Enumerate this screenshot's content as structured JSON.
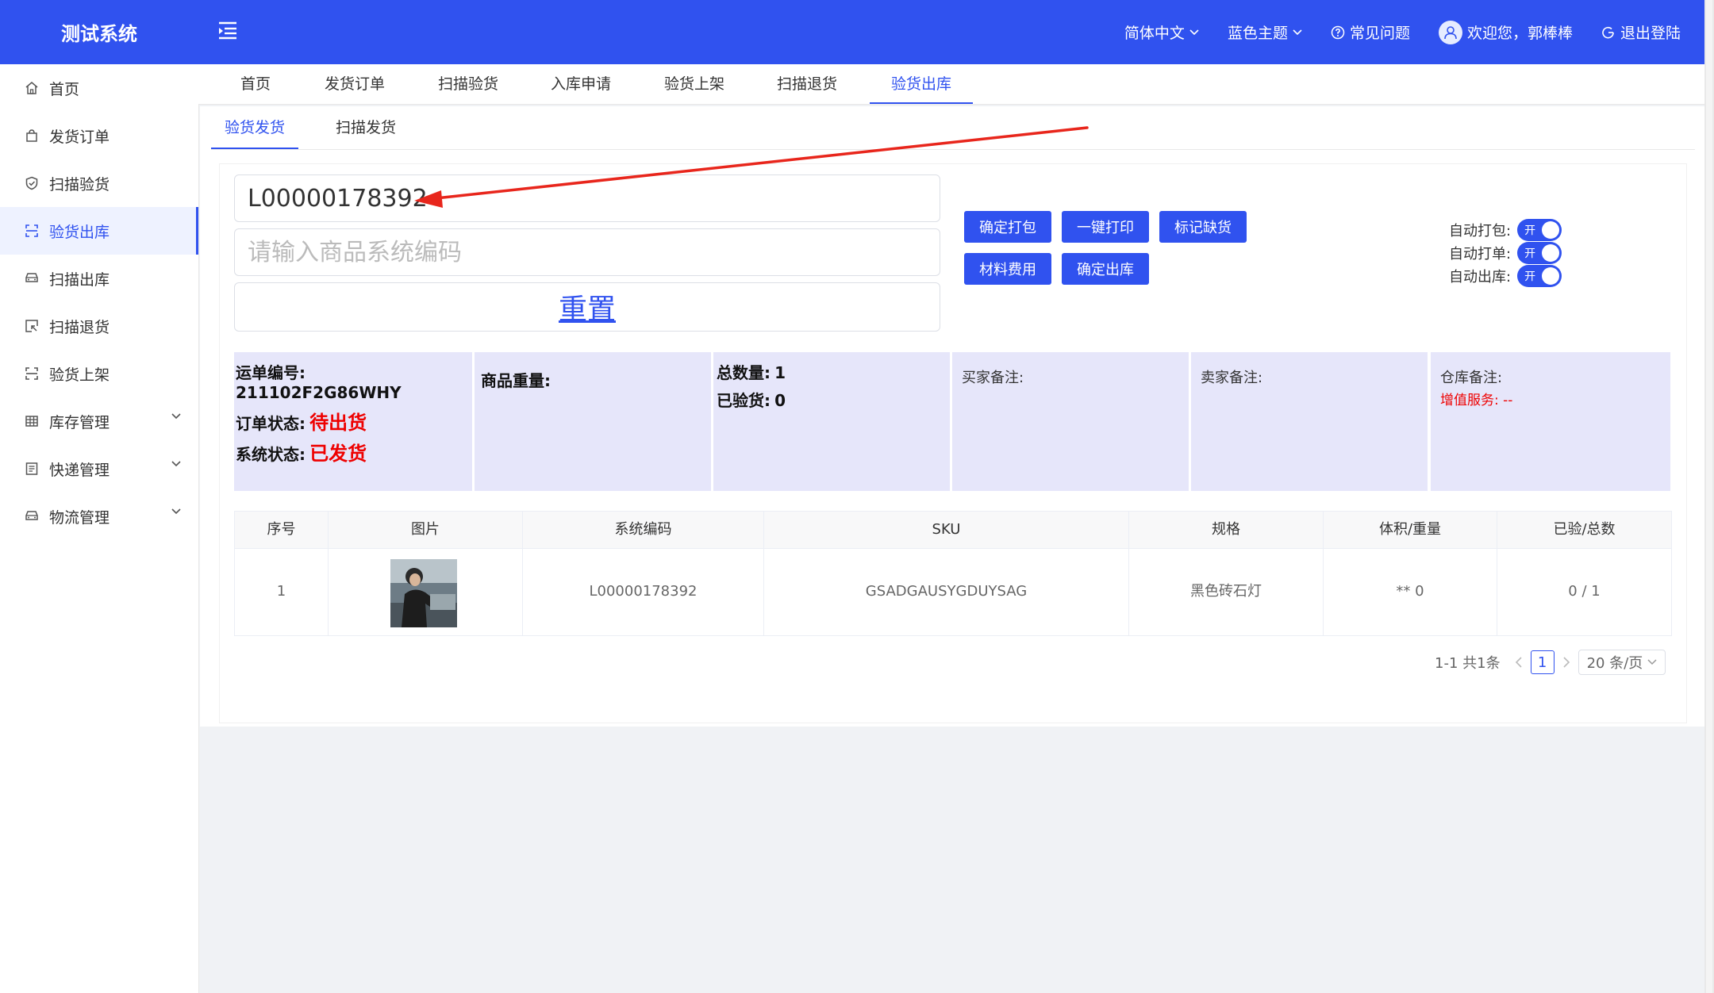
{
  "app": {
    "title": "测试系统"
  },
  "header": {
    "language": "简体中文",
    "theme": "蓝色主题",
    "faq": "常见问题",
    "welcome": "欢迎您，郭棒棒",
    "logout": "退出登陆"
  },
  "sidebar": {
    "items": [
      {
        "label": "首页",
        "icon": "home-icon"
      },
      {
        "label": "发货订单",
        "icon": "bag-icon"
      },
      {
        "label": "扫描验货",
        "icon": "shield-icon"
      },
      {
        "label": "验货出库",
        "icon": "scan-icon"
      },
      {
        "label": "扫描出库",
        "icon": "car-icon"
      },
      {
        "label": "扫描退货",
        "icon": "return-icon"
      },
      {
        "label": "验货上架",
        "icon": "scan-icon"
      },
      {
        "label": "库存管理",
        "icon": "table-icon"
      },
      {
        "label": "快递管理",
        "icon": "list-icon"
      },
      {
        "label": "物流管理",
        "icon": "truck-icon"
      }
    ],
    "active_index": 3
  },
  "tabs": [
    "首页",
    "发货订单",
    "扫描验货",
    "入库申请",
    "验货上架",
    "扫描退货",
    "验货出库"
  ],
  "subtabs": [
    "验货发货",
    "扫描发货"
  ],
  "form": {
    "waybill_value": "L00000178392",
    "product_placeholder": "请输入商品系统编码",
    "reset_label": "重置"
  },
  "actions": {
    "confirm_pack": "确定打包",
    "one_click_print": "一键打印",
    "mark_shortage": "标记缺货",
    "material_cost": "材料费用",
    "confirm_outbound": "确定出库"
  },
  "toggles": [
    {
      "label": "自动打包:",
      "state": "开"
    },
    {
      "label": "自动打单:",
      "state": "开"
    },
    {
      "label": "自动出库:",
      "state": "开"
    }
  ],
  "info": {
    "waybill_label": "运单编号:",
    "waybill_no": "211102F2G86WHY",
    "order_status_label": "订单状态:",
    "order_status": "待出货",
    "system_status_label": "系统状态:",
    "system_status": "已发货",
    "weight_label": "商品重量:",
    "total_label": "总数量:",
    "total_value": "1",
    "checked_label": "已验货:",
    "checked_value": "0",
    "buyer_note_label": "买家备注:",
    "seller_note_label": "卖家备注:",
    "warehouse_note_label": "仓库备注:",
    "value_added_label": "增值服务:",
    "value_added_value": "--"
  },
  "table": {
    "headers": [
      "序号",
      "图片",
      "系统编码",
      "SKU",
      "规格",
      "体积/重量",
      "已验/总数"
    ],
    "rows": [
      {
        "index": "1",
        "code": "L00000178392",
        "sku": "GSADGAUSYGDUYSAG",
        "spec": "黑色砖石灯",
        "volume": "** 0",
        "progress": "0 / 1"
      }
    ]
  },
  "pagination": {
    "summary": "1-1 共1条",
    "current_page": "1",
    "page_size": "20 条/页"
  },
  "colors": {
    "primary": "#3052ef",
    "info_bg": "#e6e6fa",
    "status_red": "#e00000",
    "arrow_red": "#e8261c"
  }
}
